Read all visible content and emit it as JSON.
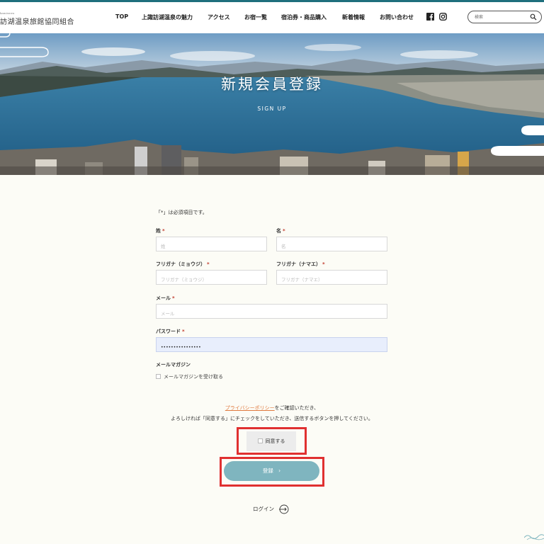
{
  "logo": {
    "small": "kamisuwa",
    "main": "訪湖温泉旅館協同組合"
  },
  "nav": [
    "TOP",
    "上諏訪湖温泉の魅力",
    "アクセス",
    "お宿一覧",
    "宿泊券・商品購入",
    "新着情報",
    "お問い合わせ"
  ],
  "social": [
    "facebook-icon",
    "instagram-icon"
  ],
  "search": {
    "placeholder": "検索"
  },
  "hero": {
    "title": "新規会員登録",
    "subtitle": "SIGN UP"
  },
  "form": {
    "required_note": "「*」は必須項目です。",
    "required_mark": "*",
    "last_name": {
      "label": "姓",
      "placeholder": "姓"
    },
    "first_name": {
      "label": "名",
      "placeholder": "名"
    },
    "last_name_kana": {
      "label": "フリガナ（ミョウジ）",
      "placeholder": "フリガナ（ミョウジ）"
    },
    "first_name_kana": {
      "label": "フリガナ（ナマエ）",
      "placeholder": "フリガナ（ナマエ）"
    },
    "email": {
      "label": "メール",
      "placeholder": "メール"
    },
    "password": {
      "label": "パスワード",
      "value": "••••••••••••••••"
    },
    "newsletter": {
      "label": "メールマガジン",
      "checkbox_label": "メールマガジンを受け取る"
    },
    "policy": {
      "link": "プライバシーポリシー",
      "line1_rest": "をご確認いただき、",
      "line2": "よろしければ「同意する」にチェックをしていただき、送信するボタンを押してください。"
    },
    "agree_label": "同意する",
    "submit_label": "登録",
    "submit_arrow": "›",
    "login_label": "ログイン"
  },
  "colors": {
    "accent": "#1f6f7d",
    "submit": "#7fb5bf",
    "highlight": "#e03030",
    "link": "#e07a3f"
  }
}
